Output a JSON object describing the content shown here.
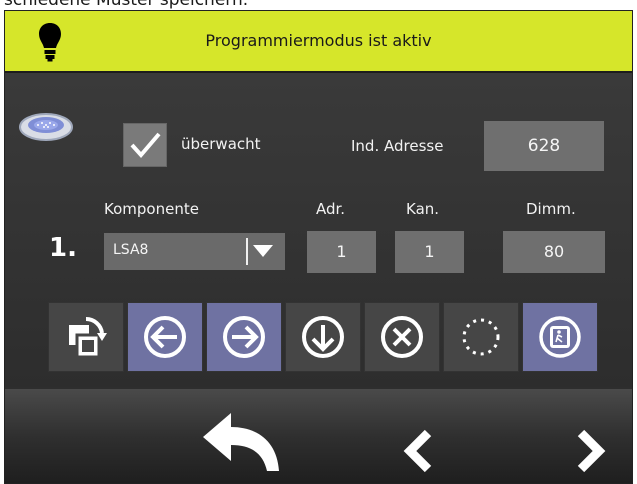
{
  "caption": "schiedene Muster speichern.",
  "status": {
    "text": "Programmiermodus ist aktiv",
    "mode_color": "#d6e62a"
  },
  "monitoring": {
    "label": "überwacht",
    "checked": true
  },
  "address": {
    "label": "Ind. Adresse",
    "value": "628"
  },
  "row": {
    "number": "1.",
    "component_label": "Komponente",
    "component_value": "LSA8",
    "adr_label": "Adr.",
    "adr_value": "1",
    "kan_label": "Kan.",
    "kan_value": "1",
    "dimm_label": "Dimm.",
    "dimm_value": "80"
  },
  "toolbar": {
    "buttons": [
      {
        "icon": "rotate-copy-icon",
        "active": false
      },
      {
        "icon": "arrow-left-icon",
        "active": true
      },
      {
        "icon": "arrow-right-icon",
        "active": true
      },
      {
        "icon": "arrow-down-icon",
        "active": false
      },
      {
        "icon": "close-circle-icon",
        "active": false
      },
      {
        "icon": "dotted-circle-icon",
        "active": false
      },
      {
        "icon": "exit-icon",
        "active": true
      }
    ]
  },
  "nav": {
    "icons": [
      "back-icon",
      "previous-icon",
      "next-icon"
    ]
  }
}
